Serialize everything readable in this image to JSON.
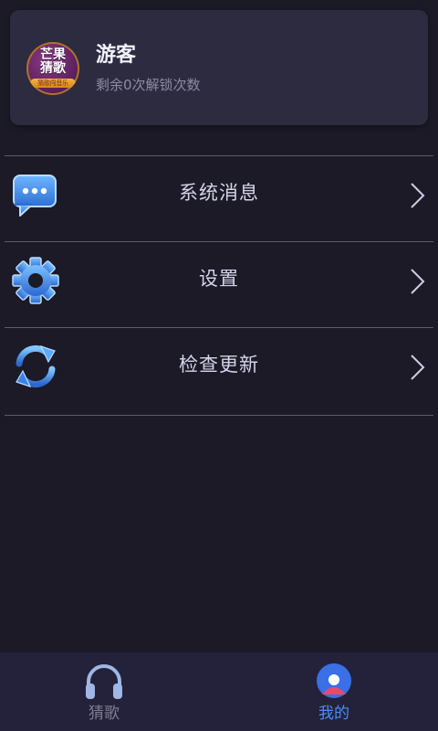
{
  "profile": {
    "avatar_line1": "芒果",
    "avatar_line2": "猜歌",
    "avatar_band": "猜歌闯音乐",
    "name": "游客",
    "unlocks_text": "剩余0次解锁次数"
  },
  "menu": {
    "items": [
      {
        "label": "系统消息",
        "icon": "chat-bubble-icon"
      },
      {
        "label": "设置",
        "icon": "gear-icon"
      },
      {
        "label": "检查更新",
        "icon": "refresh-icon"
      }
    ]
  },
  "tabbar": {
    "tabs": [
      {
        "label": "猜歌",
        "icon": "headphones-icon",
        "active": false
      },
      {
        "label": "我的",
        "icon": "user-icon",
        "active": true
      }
    ]
  },
  "colors": {
    "background": "#1b1a26",
    "card": "#2c2b40",
    "accent_blue": "#3a7fe0",
    "inactive_tab": "#7f7d93",
    "active_tab": "#4a8dff"
  }
}
